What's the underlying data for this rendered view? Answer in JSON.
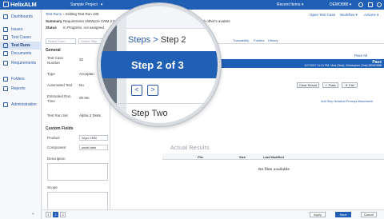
{
  "app": {
    "name": "HelixALM"
  },
  "topbar": {
    "project": "Sample Project",
    "recent": "Recent Items",
    "user": "DEMO888"
  },
  "sidebar": {
    "items": [
      {
        "label": "Dashboards"
      },
      {
        "label": "Issues"
      },
      {
        "label": "Test Cases"
      },
      {
        "label": "Test Runs"
      },
      {
        "label": "Documents"
      },
      {
        "label": "Requirements"
      },
      {
        "label": "Folders"
      },
      {
        "label": "Reports"
      },
      {
        "label": "Administration"
      }
    ],
    "collapse": "«"
  },
  "breadcrumb": {
    "root": "Test Runs",
    "sep": "»",
    "current": "Editing Test Run 105"
  },
  "toplinks": {
    "open": "Open Test Case",
    "workflow": "Workflow",
    "actions": "Actions"
  },
  "summary": {
    "summary_label": "Summary",
    "summary_value": "Requirement 156Wyze CRM 2.5 needs a cost \"social widget\" where people can see each other's avatars",
    "status_label": "Status",
    "status_value": "In Progress, not assigned"
  },
  "leftpanel": {
    "select1": "Select Form",
    "select2": "Select Step",
    "general": "General",
    "fields": [
      {
        "label": "Test Case Number",
        "value": "32"
      },
      {
        "label": "Type",
        "value": "Acceptan"
      },
      {
        "label": "Automated Test",
        "value": "No"
      },
      {
        "label": "Estimated Run Time",
        "value": "0h 0m"
      },
      {
        "label": "Test Run Set",
        "value": "Alpha 2 Tests"
      }
    ],
    "custom": "Custom Fields",
    "product_label": "Product",
    "product_value": "Wyzi CRM",
    "component_label": "Component",
    "component_value": "small tabs",
    "description": "Description",
    "scope": "Scope"
  },
  "steps": {
    "crumb_root": "Steps",
    "crumb_current": "Step 2",
    "title": "Step 2 of 3",
    "prev": "<",
    "next": ">",
    "step_name": "Step Two",
    "tabs": [
      "Traceability",
      "Folders",
      "History"
    ]
  },
  "resultbar": {
    "pass_all": "Pass All",
    "result": "Pass",
    "meta": "11/7/2017 11:31 PM: Viral (Test), Christopher (Test) DEMO888"
  },
  "buttons": {
    "clear": "Clear Result",
    "pass": "Pass",
    "fail": "Fail",
    "add_step": "Add Step Now",
    "add_prereq": "Add Prereqs Attachment"
  },
  "actual": {
    "heading": "Actual Results"
  },
  "files": {
    "columns": [
      "File",
      "Size",
      "Last Modified"
    ],
    "empty": "No files available"
  },
  "footer": {
    "pages": [
      "1",
      "2",
      "3"
    ],
    "apply": "Apply",
    "save": "Save",
    "cancel": "Cancel"
  }
}
